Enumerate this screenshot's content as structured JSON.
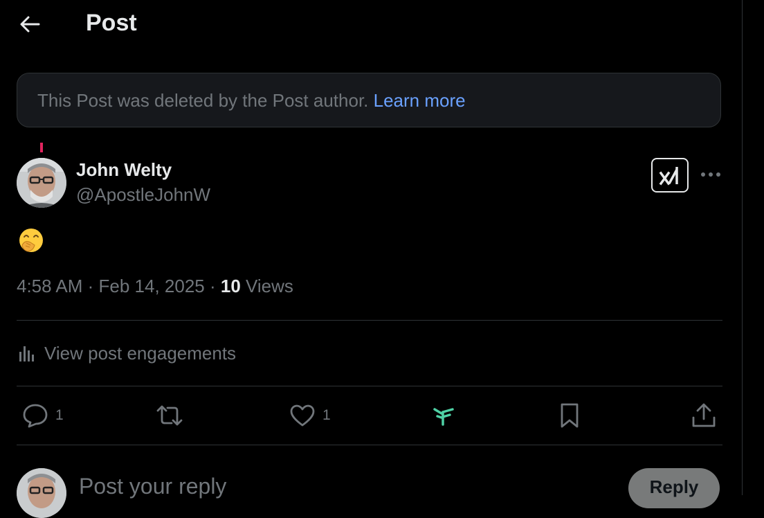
{
  "header": {
    "title": "Post"
  },
  "notice": {
    "text": "This Post was deleted by the Post author. ",
    "link": "Learn more"
  },
  "author": {
    "name": "John Welty",
    "handle": "@ApostleJohnW"
  },
  "post": {
    "emoji": "🤭",
    "time": "4:58 AM",
    "separator": " · ",
    "date": "Feb 14, 2025",
    "views_count": "10",
    "views_label": " Views"
  },
  "engagements": {
    "label": "View post engagements"
  },
  "actions": {
    "reply_count": "1",
    "like_count": "1"
  },
  "reply": {
    "placeholder": "Post your reply",
    "button": "Reply"
  },
  "colors": {
    "link": "#6aa1ff",
    "grok_accent": "#1d9bf0",
    "muted": "#71767b"
  }
}
